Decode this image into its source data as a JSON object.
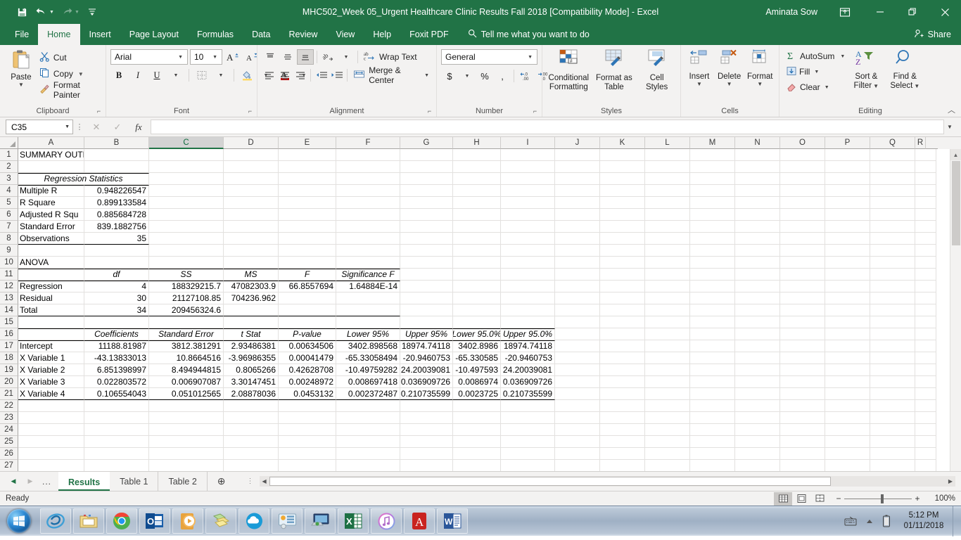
{
  "window": {
    "title": "MHC502_Week 05_Urgent Healthcare Clinic Results Fall 2018  [Compatibility Mode]  -  Excel",
    "user": "Aminata Sow",
    "minimize": "—",
    "restore": "❐",
    "close": "✕",
    "ribbon_display_icon": "ribbon-display-options-icon"
  },
  "quick_access": {
    "save": "save-icon",
    "undo": "undo-icon",
    "redo": "redo-icon",
    "customize": "customize-qat-icon"
  },
  "tabs": [
    {
      "label": "File",
      "active": false
    },
    {
      "label": "Home",
      "active": true
    },
    {
      "label": "Insert",
      "active": false
    },
    {
      "label": "Page Layout",
      "active": false
    },
    {
      "label": "Formulas",
      "active": false
    },
    {
      "label": "Data",
      "active": false
    },
    {
      "label": "Review",
      "active": false
    },
    {
      "label": "View",
      "active": false
    },
    {
      "label": "Help",
      "active": false
    },
    {
      "label": "Foxit PDF",
      "active": false
    }
  ],
  "tell_me": "Tell me what you want to do",
  "share": "Share",
  "ribbon": {
    "clipboard": {
      "group_label": "Clipboard",
      "paste": "Paste",
      "cut": "Cut",
      "copy": "Copy",
      "format_painter": "Format Painter"
    },
    "font": {
      "group_label": "Font",
      "font_name": "Arial",
      "font_size": "10",
      "grow_font": "A",
      "shrink_font": "A",
      "bold": "B",
      "italic": "I",
      "underline": "U"
    },
    "alignment": {
      "group_label": "Alignment",
      "wrap_text": "Wrap Text",
      "merge_center": "Merge & Center"
    },
    "number": {
      "group_label": "Number",
      "format": "General",
      "currency": "$",
      "percent": "%",
      "comma": ","
    },
    "styles": {
      "group_label": "Styles",
      "conditional_formatting": "Conditional\nFormatting",
      "conditional_formatting_l1": "Conditional",
      "conditional_formatting_l2": "Formatting",
      "format_as_table_l1": "Format as",
      "format_as_table_l2": "Table",
      "cell_styles_l1": "Cell",
      "cell_styles_l2": "Styles"
    },
    "cells": {
      "group_label": "Cells",
      "insert": "Insert",
      "delete": "Delete",
      "format": "Format"
    },
    "editing": {
      "group_label": "Editing",
      "autosum": "AutoSum",
      "fill": "Fill",
      "clear": "Clear",
      "sort_filter_l1": "Sort &",
      "sort_filter_l2": "Filter",
      "find_select_l1": "Find &",
      "find_select_l2": "Select"
    }
  },
  "formula_bar": {
    "name_box": "C35",
    "cancel": "✕",
    "enter": "✓",
    "insert_function": "fx",
    "content": ""
  },
  "grid": {
    "columns": [
      "A",
      "B",
      "C",
      "D",
      "E",
      "F",
      "G",
      "H",
      "I",
      "J",
      "K",
      "L",
      "M",
      "N",
      "O",
      "P",
      "Q",
      "R"
    ],
    "selected_column": "C",
    "rows": [
      "1",
      "2",
      "3",
      "4",
      "5",
      "6",
      "7",
      "8",
      "9",
      "10",
      "11",
      "12",
      "13",
      "14",
      "15",
      "16",
      "17",
      "18",
      "19",
      "20",
      "21",
      "22",
      "23",
      "24",
      "25",
      "26",
      "27"
    ],
    "cells": {
      "A1": "SUMMARY OUTPUT",
      "A3_merged": "Regression Statistics",
      "A4": "Multiple R",
      "B4": "0.948226547",
      "A5": "R Square",
      "B5": "0.899133584",
      "A6": "Adjusted R Squ",
      "B6": "0.885684728",
      "A7": "Standard Error",
      "B7": "839.1882756",
      "A8": "Observations",
      "B8": "35",
      "A10": "ANOVA",
      "B11": "df",
      "C11": "SS",
      "D11": "MS",
      "E11": "F",
      "F11": "Significance F",
      "A12": "Regression",
      "B12": "4",
      "C12": "188329215.7",
      "D12": "47082303.9",
      "E12": "66.8557694",
      "F12": "1.64884E-14",
      "A13": "Residual",
      "B13": "30",
      "C13": "21127108.85",
      "D13": "704236.962",
      "E13": "",
      "F13": "",
      "A14": "Total",
      "B14": "34",
      "C14": "209456324.6",
      "D14": "",
      "E14": "",
      "F14": "",
      "B16": "Coefficients",
      "C16": "Standard Error",
      "D16": "t Stat",
      "E16": "P-value",
      "F16": "Lower 95%",
      "G16": "Upper 95%",
      "H16": "Lower 95.0%",
      "I16": "Upper 95.0%",
      "A17": "Intercept",
      "B17": "11188.81987",
      "C17": "3812.381291",
      "D17": "2.93486381",
      "E17": "0.00634506",
      "F17": "3402.898568",
      "G17": "18974.74118",
      "H17": "3402.8986",
      "I17": "18974.74118",
      "A18": "X Variable 1",
      "B18": "-43.13833013",
      "C18": "10.8664516",
      "D18": "-3.96986355",
      "E18": "0.00041479",
      "F18": "-65.33058494",
      "G18": "-20.9460753",
      "H18": "-65.330585",
      "I18": "-20.9460753",
      "A19": "X Variable 2",
      "B19": "6.851398997",
      "C19": "8.494944815",
      "D19": "0.8065266",
      "E19": "0.42628708",
      "F19": "-10.49759282",
      "G19": "24.20039081",
      "H19": "-10.497593",
      "I19": "24.20039081",
      "A20": "X Variable 3",
      "B20": "0.022803572",
      "C20": "0.006907087",
      "D20": "3.30147451",
      "E20": "0.00248972",
      "F20": "0.008697418",
      "G20": "0.036909726",
      "H20": "0.0086974",
      "I20": "0.036909726",
      "A21": "X Variable 4",
      "B21": "0.106554043",
      "C21": "0.051012565",
      "D21": "2.08878036",
      "E21": "0.0453132",
      "F21": "0.002372487",
      "G21": "0.210735599",
      "H21": "0.0023725",
      "I21": "0.210735599"
    }
  },
  "sheet_tabs": {
    "prev": "◀",
    "next": "▶",
    "ellipsis": "...",
    "tabs": [
      {
        "label": "Results",
        "active": true
      },
      {
        "label": "Table 1",
        "active": false
      },
      {
        "label": "Table 2",
        "active": false
      }
    ],
    "add": "⊕"
  },
  "status_bar": {
    "status": "Ready",
    "view_normal": "normal-view-icon",
    "view_page_layout": "page-layout-view-icon",
    "view_page_break": "page-break-preview-icon",
    "zoom_out": "−",
    "zoom_in": "+",
    "zoom": "100%"
  },
  "taskbar": {
    "start": "start-orb-icon",
    "items": [
      "internet-explorer-icon",
      "file-explorer-icon",
      "google-chrome-icon",
      "outlook-icon",
      "windows-media-player-icon",
      "sticky-notes-icon",
      "onedrive-icon",
      "control-panel-icon",
      "remote-desktop-icon",
      "excel-icon",
      "itunes-icon",
      "adobe-reader-icon",
      "word-icon"
    ],
    "tray": [
      "keyboard-icon",
      "show-hidden-icons-icon",
      "battery-icon"
    ],
    "time": "5:12 PM",
    "date": "01/11/2018"
  }
}
